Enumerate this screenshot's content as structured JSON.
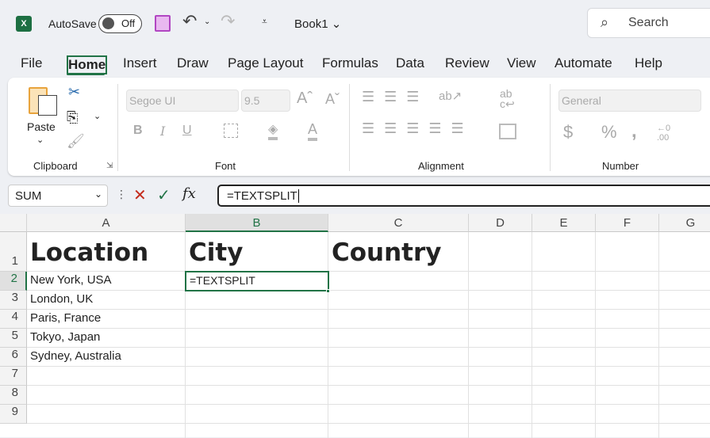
{
  "titlebar": {
    "autosave_label": "AutoSave",
    "autosave_state": "Off",
    "workbook": "Book1",
    "search_placeholder": "Search"
  },
  "tabs": [
    "File",
    "Home",
    "Insert",
    "Draw",
    "Page Layout",
    "Formulas",
    "Data",
    "Review",
    "View",
    "Automate",
    "Help"
  ],
  "active_tab": "Home",
  "ribbon": {
    "paste_label": "Paste",
    "groups": [
      "Clipboard",
      "Font",
      "Alignment",
      "Number"
    ],
    "font_name": "Segoe UI",
    "font_size": "9.5",
    "number_format": "General"
  },
  "formula_bar": {
    "name_box": "SUM",
    "fx": "fx",
    "formula": "=TEXTSPLIT"
  },
  "columns": [
    "A",
    "B",
    "C",
    "D",
    "E",
    "F",
    "G"
  ],
  "rows": [
    "1",
    "2",
    "3",
    "4",
    "5",
    "6",
    "7",
    "8",
    "9"
  ],
  "cells": {
    "A1": "Location",
    "B1": "City",
    "C1": "Country",
    "A2": "New York, USA",
    "A3": "London, UK",
    "A4": "Paris, France",
    "A5": "Tokyo, Japan",
    "A6": "Sydney, Australia",
    "B2": "=TEXTSPLIT"
  },
  "colors": {
    "accent": "#217346",
    "save_icon": "#b146c2"
  }
}
